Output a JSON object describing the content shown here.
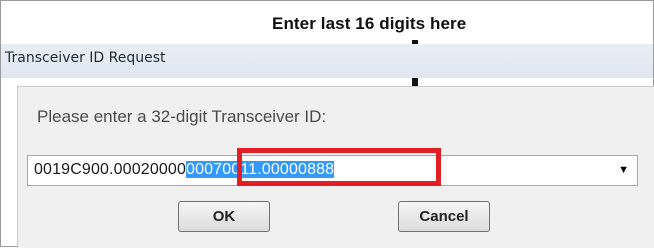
{
  "annotation": {
    "callout_text": "Enter last 16 digits here"
  },
  "window": {
    "title": "Transceiver ID Request"
  },
  "dialog": {
    "prompt": "Please enter a 32-digit Transceiver ID:",
    "field": {
      "value_prefix": "0019C900.00020000",
      "value_selected": "00070011.00000888",
      "dropdown_icon": "triangle-down"
    },
    "buttons": {
      "ok_label": "OK",
      "cancel_label": "Cancel"
    }
  },
  "colors": {
    "selection": "#3399ff",
    "highlight_box": "#e21f26"
  }
}
